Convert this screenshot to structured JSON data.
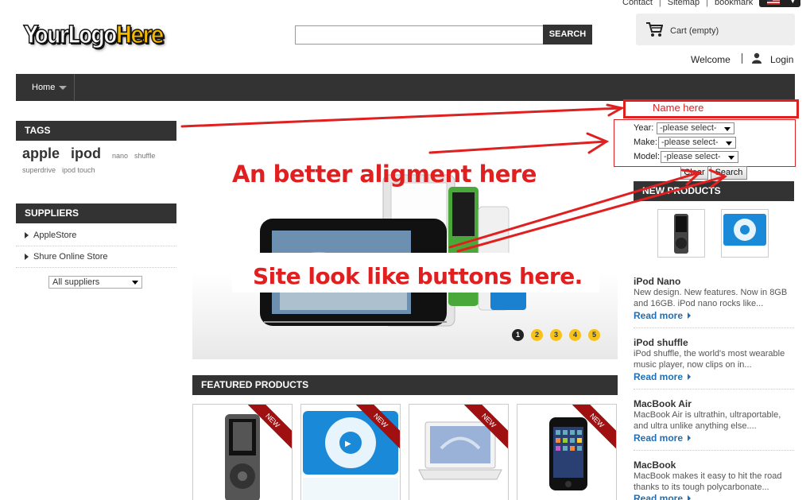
{
  "toplinks": {
    "contact": "Contact",
    "sitemap": "Sitemap",
    "bookmark": "bookmark"
  },
  "logo": {
    "part1": "YourLogo",
    "part2": "Here"
  },
  "search": {
    "button": "SEARCH",
    "placeholder": ""
  },
  "cart": {
    "label": "Cart (empty)"
  },
  "user": {
    "welcome": "Welcome",
    "login": "Login"
  },
  "nav": {
    "home": "Home"
  },
  "tags": {
    "title": "TAGS",
    "big": [
      "apple",
      "ipod"
    ],
    "small": [
      "nano",
      "shuffle"
    ],
    "line2": [
      "superdrive",
      "ipod touch"
    ]
  },
  "suppliers": {
    "title": "SUPPLIERS",
    "items": [
      "AppleStore",
      "Shure Online Store"
    ],
    "select": "All suppliers"
  },
  "filter": {
    "name_placeholder": "Name here",
    "year_label": "Year:",
    "make_label": "Make:",
    "model_label": "Model:",
    "select_default": "-please select-",
    "clear": "Clear",
    "search": "Search"
  },
  "annotations": {
    "alignment": "An better aligment here",
    "buttons": "Site look like buttons here."
  },
  "slider": {
    "dots": [
      "1",
      "2",
      "3",
      "4",
      "5"
    ],
    "active": 1
  },
  "featured": {
    "title": "FEATURED PRODUCTS",
    "ribbon": "NEW"
  },
  "new_products": {
    "title": "NEW PRODUCTS",
    "items": [
      {
        "title": "iPod Nano",
        "desc": "New design. New features. Now in 8GB and 16GB. iPod nano rocks like...",
        "more": "Read more"
      },
      {
        "title": "iPod shuffle",
        "desc": "iPod shuffle, the world's most wearable music player, now clips on in...",
        "more": "Read more"
      },
      {
        "title": "MacBook Air",
        "desc": "MacBook Air is ultrathin, ultraportable, and ultra unlike anything else....",
        "more": "Read more"
      },
      {
        "title": "MacBook",
        "desc": "MacBook makes it easy to hit the road thanks to its tough polycarbonate...",
        "more": "Read more"
      }
    ]
  },
  "colors": {
    "annotation_red": "#e02020",
    "bar_dark": "#333333",
    "link_blue": "#1e6fb5",
    "dot_yellow": "#f4c21a"
  }
}
